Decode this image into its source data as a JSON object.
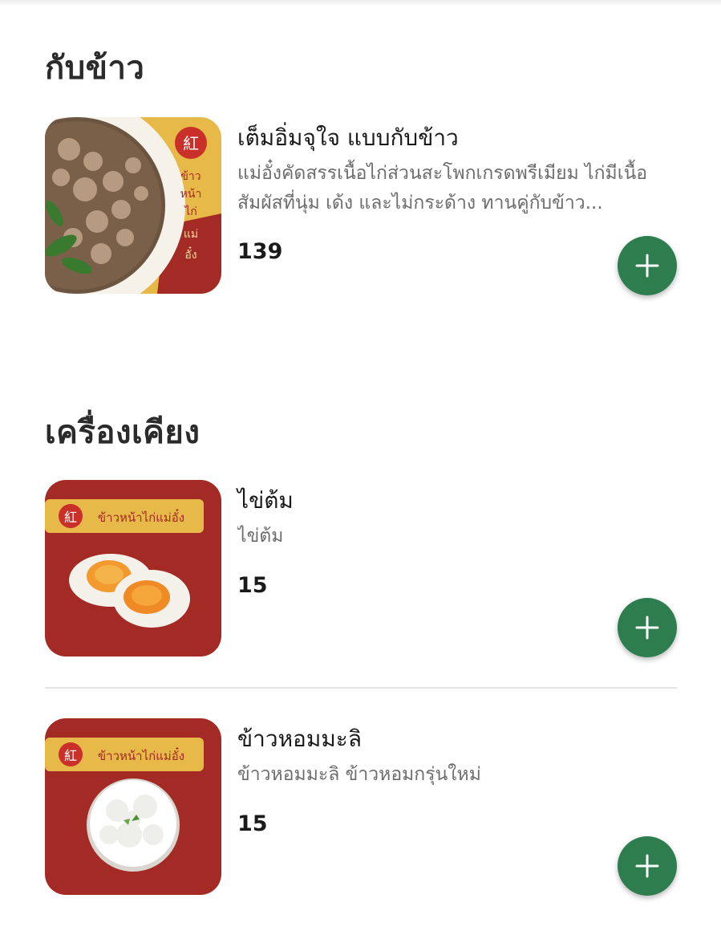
{
  "sections": [
    {
      "title": "กับข้าว",
      "items": [
        {
          "name": "เต็มอิ่มจุใจ แบบกับข้าว",
          "description": "แม่อั๋งคัดสรรเนื้อไก่ส่วนสะโพกเกรดพรีเมียม ไก่มีเนื้อสัมผัสที่นุ่ม เด้ง และไม่กระด้าง ทานคู่กับข้าว...",
          "price": "139",
          "image_icon": "chicken-curry-photo",
          "brand_text": "ข้าวหน้าไก่แม่อั๋ง"
        }
      ]
    },
    {
      "title": "เครื่องเคียง",
      "items": [
        {
          "name": "ไข่ต้ม",
          "description": "ไข่ต้ม",
          "price": "15",
          "image_icon": "boiled-egg-photo",
          "brand_text": "ข้าวหน้าไก่แม่อั๋ง"
        },
        {
          "name": "ข้าวหอมมะลิ",
          "description": "ข้าวหอมมะลิ ข้าวหอมกรุ่นใหม่",
          "price": "15",
          "image_icon": "jasmine-rice-photo",
          "brand_text": "ข้าวหน้าไก่แม่อั๋ง"
        }
      ]
    }
  ],
  "colors": {
    "add_button": "#2e7d4f",
    "brand_red": "#a32a25",
    "brand_yellow": "#e7b948"
  },
  "icons": {
    "add_button_icon": "plus-icon"
  }
}
